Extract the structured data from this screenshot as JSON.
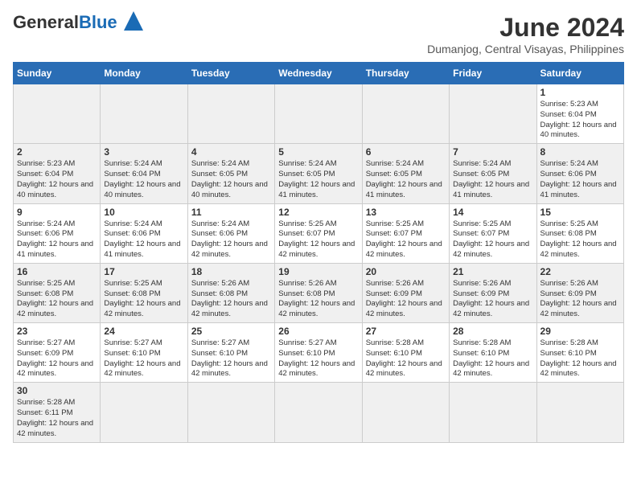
{
  "header": {
    "logo_general": "General",
    "logo_blue": "Blue",
    "month_title": "June 2024",
    "subtitle": "Dumanjog, Central Visayas, Philippines"
  },
  "days_of_week": [
    "Sunday",
    "Monday",
    "Tuesday",
    "Wednesday",
    "Thursday",
    "Friday",
    "Saturday"
  ],
  "weeks": [
    {
      "days": [
        {
          "num": "",
          "info": ""
        },
        {
          "num": "",
          "info": ""
        },
        {
          "num": "",
          "info": ""
        },
        {
          "num": "",
          "info": ""
        },
        {
          "num": "",
          "info": ""
        },
        {
          "num": "",
          "info": ""
        },
        {
          "num": "1",
          "info": "Sunrise: 5:23 AM\nSunset: 6:04 PM\nDaylight: 12 hours and 40 minutes."
        }
      ]
    },
    {
      "days": [
        {
          "num": "2",
          "info": "Sunrise: 5:23 AM\nSunset: 6:04 PM\nDaylight: 12 hours and 40 minutes."
        },
        {
          "num": "3",
          "info": "Sunrise: 5:24 AM\nSunset: 6:04 PM\nDaylight: 12 hours and 40 minutes."
        },
        {
          "num": "4",
          "info": "Sunrise: 5:24 AM\nSunset: 6:05 PM\nDaylight: 12 hours and 40 minutes."
        },
        {
          "num": "5",
          "info": "Sunrise: 5:24 AM\nSunset: 6:05 PM\nDaylight: 12 hours and 41 minutes."
        },
        {
          "num": "6",
          "info": "Sunrise: 5:24 AM\nSunset: 6:05 PM\nDaylight: 12 hours and 41 minutes."
        },
        {
          "num": "7",
          "info": "Sunrise: 5:24 AM\nSunset: 6:05 PM\nDaylight: 12 hours and 41 minutes."
        },
        {
          "num": "8",
          "info": "Sunrise: 5:24 AM\nSunset: 6:06 PM\nDaylight: 12 hours and 41 minutes."
        }
      ]
    },
    {
      "days": [
        {
          "num": "9",
          "info": "Sunrise: 5:24 AM\nSunset: 6:06 PM\nDaylight: 12 hours and 41 minutes."
        },
        {
          "num": "10",
          "info": "Sunrise: 5:24 AM\nSunset: 6:06 PM\nDaylight: 12 hours and 41 minutes."
        },
        {
          "num": "11",
          "info": "Sunrise: 5:24 AM\nSunset: 6:06 PM\nDaylight: 12 hours and 42 minutes."
        },
        {
          "num": "12",
          "info": "Sunrise: 5:25 AM\nSunset: 6:07 PM\nDaylight: 12 hours and 42 minutes."
        },
        {
          "num": "13",
          "info": "Sunrise: 5:25 AM\nSunset: 6:07 PM\nDaylight: 12 hours and 42 minutes."
        },
        {
          "num": "14",
          "info": "Sunrise: 5:25 AM\nSunset: 6:07 PM\nDaylight: 12 hours and 42 minutes."
        },
        {
          "num": "15",
          "info": "Sunrise: 5:25 AM\nSunset: 6:08 PM\nDaylight: 12 hours and 42 minutes."
        }
      ]
    },
    {
      "days": [
        {
          "num": "16",
          "info": "Sunrise: 5:25 AM\nSunset: 6:08 PM\nDaylight: 12 hours and 42 minutes."
        },
        {
          "num": "17",
          "info": "Sunrise: 5:25 AM\nSunset: 6:08 PM\nDaylight: 12 hours and 42 minutes."
        },
        {
          "num": "18",
          "info": "Sunrise: 5:26 AM\nSunset: 6:08 PM\nDaylight: 12 hours and 42 minutes."
        },
        {
          "num": "19",
          "info": "Sunrise: 5:26 AM\nSunset: 6:08 PM\nDaylight: 12 hours and 42 minutes."
        },
        {
          "num": "20",
          "info": "Sunrise: 5:26 AM\nSunset: 6:09 PM\nDaylight: 12 hours and 42 minutes."
        },
        {
          "num": "21",
          "info": "Sunrise: 5:26 AM\nSunset: 6:09 PM\nDaylight: 12 hours and 42 minutes."
        },
        {
          "num": "22",
          "info": "Sunrise: 5:26 AM\nSunset: 6:09 PM\nDaylight: 12 hours and 42 minutes."
        }
      ]
    },
    {
      "days": [
        {
          "num": "23",
          "info": "Sunrise: 5:27 AM\nSunset: 6:09 PM\nDaylight: 12 hours and 42 minutes."
        },
        {
          "num": "24",
          "info": "Sunrise: 5:27 AM\nSunset: 6:10 PM\nDaylight: 12 hours and 42 minutes."
        },
        {
          "num": "25",
          "info": "Sunrise: 5:27 AM\nSunset: 6:10 PM\nDaylight: 12 hours and 42 minutes."
        },
        {
          "num": "26",
          "info": "Sunrise: 5:27 AM\nSunset: 6:10 PM\nDaylight: 12 hours and 42 minutes."
        },
        {
          "num": "27",
          "info": "Sunrise: 5:28 AM\nSunset: 6:10 PM\nDaylight: 12 hours and 42 minutes."
        },
        {
          "num": "28",
          "info": "Sunrise: 5:28 AM\nSunset: 6:10 PM\nDaylight: 12 hours and 42 minutes."
        },
        {
          "num": "29",
          "info": "Sunrise: 5:28 AM\nSunset: 6:10 PM\nDaylight: 12 hours and 42 minutes."
        }
      ]
    },
    {
      "days": [
        {
          "num": "30",
          "info": "Sunrise: 5:28 AM\nSunset: 6:11 PM\nDaylight: 12 hours and 42 minutes."
        },
        {
          "num": "",
          "info": ""
        },
        {
          "num": "",
          "info": ""
        },
        {
          "num": "",
          "info": ""
        },
        {
          "num": "",
          "info": ""
        },
        {
          "num": "",
          "info": ""
        },
        {
          "num": "",
          "info": ""
        }
      ]
    }
  ]
}
